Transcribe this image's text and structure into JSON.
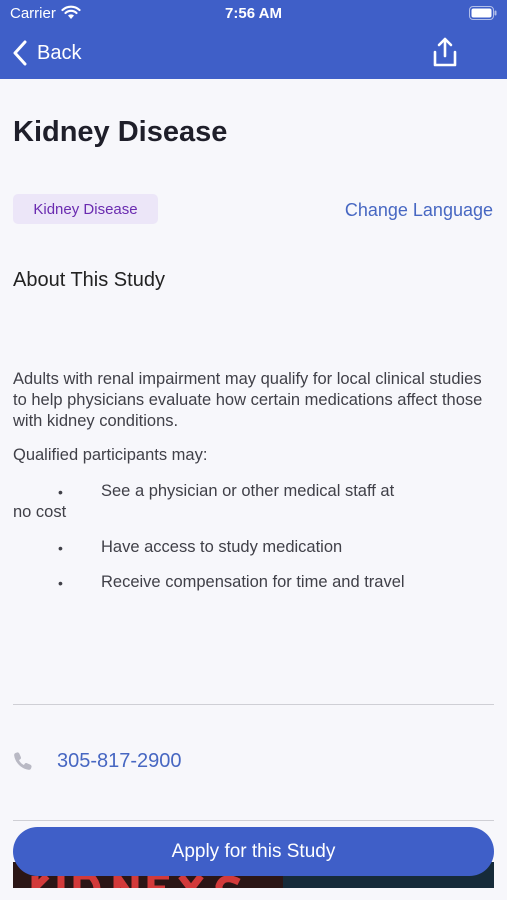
{
  "status_bar": {
    "carrier": "Carrier",
    "time": "7:56 AM"
  },
  "nav": {
    "back_label": "Back"
  },
  "study": {
    "title": "Kidney Disease",
    "tag": "Kidney Disease",
    "change_language": "Change Language",
    "about_heading": "About This Study",
    "description": "Adults with renal impairment may qualify for local clinical studies to help physicians evaluate how certain medications affect those with kidney conditions.",
    "qualified_intro": "Qualified participants may:",
    "benefits": [
      {
        "bullet": "•",
        "line1": "See a physician or other medical staff at",
        "line2": "no cost"
      },
      {
        "bullet": "•",
        "line1": "Have access to study medication"
      },
      {
        "bullet": "•",
        "line1": "Receive compensation for time and travel"
      }
    ]
  },
  "contact": {
    "phone": "305-817-2900"
  },
  "actions": {
    "apply_label": "Apply for this Study"
  },
  "colors": {
    "header": "#3f5fc8",
    "link": "#4767c2",
    "tag_bg": "#ece6f8",
    "tag_text": "#6a2bb0"
  },
  "icons": [
    "wifi-icon",
    "battery-icon",
    "back-chevron-icon",
    "share-icon",
    "phone-icon"
  ]
}
